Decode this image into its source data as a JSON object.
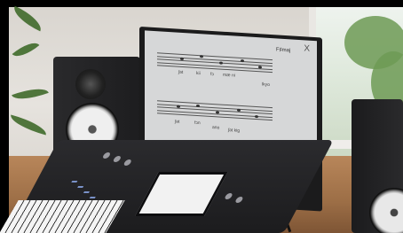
{
  "monitor": {
    "key_label": "F♯maj",
    "close_label": "X",
    "lyrics_line1": [
      "ʃət",
      "kii",
      "fɔ",
      "mæ ni",
      "lkyo"
    ],
    "lyrics_line2": [
      "ʃət",
      "fɔn",
      "ano",
      "ʃət kig"
    ],
    "toolbar_icons": [
      "speaker-icon",
      "monitor-icon",
      "gear-icon"
    ]
  }
}
